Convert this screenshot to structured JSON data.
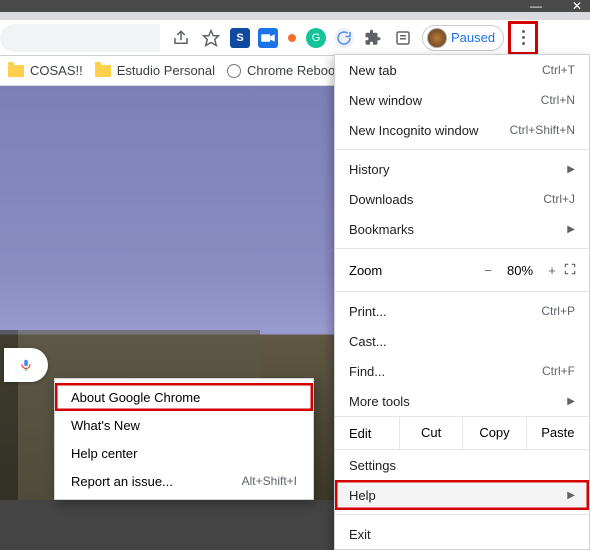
{
  "window_controls": {
    "minimize": "—",
    "close": "✕"
  },
  "toolbar": {
    "share_icon": "share-icon",
    "star_icon": "star-icon",
    "ext_s": "S",
    "ext_g": "G",
    "paused_label": "Paused"
  },
  "bookmarks": [
    {
      "type": "folder",
      "label": "COSAS!!"
    },
    {
      "type": "folder",
      "label": "Estudio Personal"
    },
    {
      "type": "link",
      "label": "Chrome Reboot"
    }
  ],
  "menu": {
    "new_tab": {
      "label": "New tab",
      "accel": "Ctrl+T"
    },
    "new_window": {
      "label": "New window",
      "accel": "Ctrl+N"
    },
    "new_incognito": {
      "label": "New Incognito window",
      "accel": "Ctrl+Shift+N"
    },
    "history": {
      "label": "History"
    },
    "downloads": {
      "label": "Downloads",
      "accel": "Ctrl+J"
    },
    "bookmarks": {
      "label": "Bookmarks"
    },
    "zoom": {
      "label": "Zoom",
      "minus": "−",
      "pct": "80%",
      "plus": "+"
    },
    "print": {
      "label": "Print...",
      "accel": "Ctrl+P"
    },
    "cast": {
      "label": "Cast..."
    },
    "find": {
      "label": "Find...",
      "accel": "Ctrl+F"
    },
    "more_tools": {
      "label": "More tools"
    },
    "edit": {
      "label": "Edit",
      "cut": "Cut",
      "copy": "Copy",
      "paste": "Paste"
    },
    "settings": {
      "label": "Settings"
    },
    "help": {
      "label": "Help"
    },
    "exit": {
      "label": "Exit"
    }
  },
  "help_submenu": {
    "about": {
      "label": "About Google Chrome"
    },
    "whatsnew": {
      "label": "What's New"
    },
    "center": {
      "label": "Help center"
    },
    "report": {
      "label": "Report an issue...",
      "accel": "Alt+Shift+I"
    }
  }
}
